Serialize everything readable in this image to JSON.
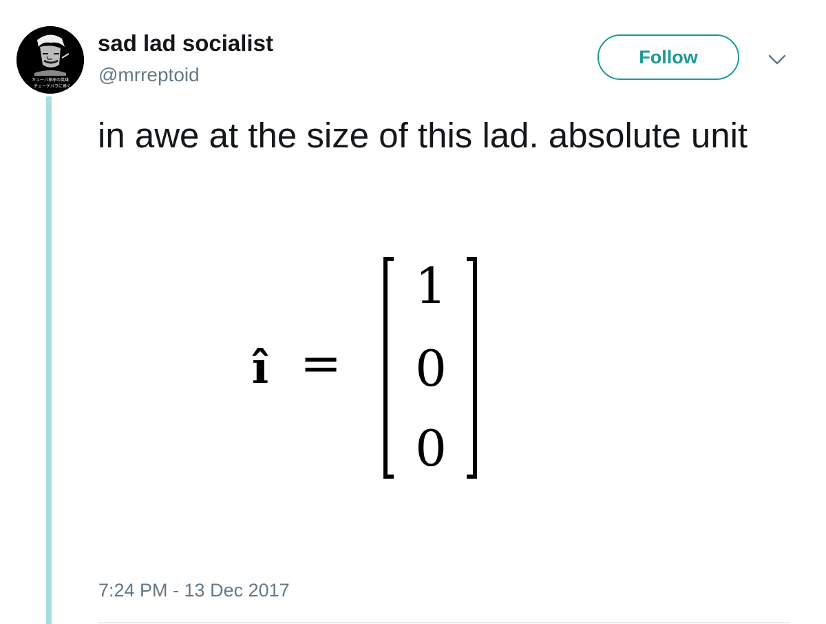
{
  "user": {
    "display_name": "sad lad socialist",
    "handle": "@mrreptoid",
    "avatar_caption_line1": "キューバ革命の英雄",
    "avatar_caption_line2": "チェ・ゲバラに捧ぐ"
  },
  "actions": {
    "follow_label": "Follow",
    "menu_icon": "chevron-down-icon"
  },
  "tweet": {
    "text": "in awe at the size of this lad. absolute unit",
    "media": {
      "lhs": "î",
      "equals": "=",
      "vector": [
        "1",
        "0",
        "0"
      ]
    },
    "timestamp": "7:24 PM - 13 Dec 2017"
  },
  "colors": {
    "accent": "#1b9a96",
    "thread_line": "#a6dfdc",
    "text_primary": "#14171a",
    "text_secondary": "#657786",
    "divider": "#e6ecf0"
  }
}
